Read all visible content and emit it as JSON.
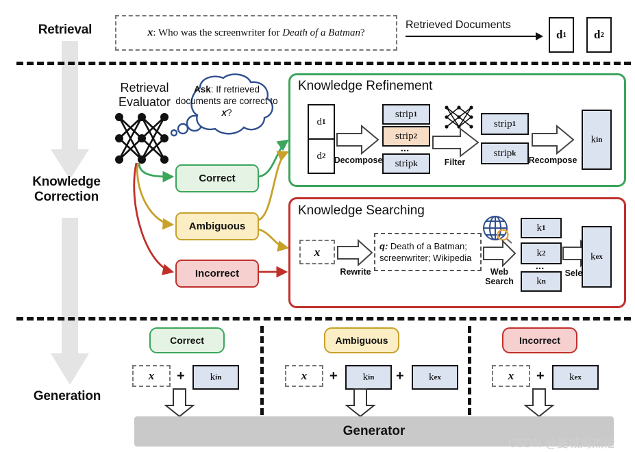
{
  "stages": [
    {
      "id": "retrieval",
      "label": "Retrieval"
    },
    {
      "id": "correction",
      "label": "Knowledge\nCorrection",
      "line1": "Knowledge",
      "line2": "Correction"
    },
    {
      "id": "generation",
      "label": "Generation"
    }
  ],
  "retrieval": {
    "query_prefix": "x",
    "query_text": ": Who was the screenwriter for ",
    "query_italic": "Death of a Batman",
    "query_suffix": "?",
    "arrow_label": "Retrieved Documents",
    "documents": [
      {
        "base": "d",
        "sub": "1"
      },
      {
        "base": "d",
        "sub": "2"
      }
    ]
  },
  "evaluator": {
    "title_line1": "Retrieval",
    "title_line2": "Evaluator",
    "bubble_bold": "Ask",
    "bubble_rest": ": If retrieved documents are correct to ",
    "bubble_var": "x",
    "bubble_end": "?"
  },
  "categories": [
    {
      "id": "correct",
      "label": "Correct",
      "border": "#3ba55c",
      "fill": "#e4f3e3"
    },
    {
      "id": "ambiguous",
      "label": "Ambiguous",
      "border": "#c8a12a",
      "fill": "#fbeec4"
    },
    {
      "id": "incorrect",
      "label": "Incorrect",
      "border": "#c0302b",
      "fill": "#f6cfcf"
    }
  ],
  "refinement": {
    "title": "Knowledge Refinement",
    "border": "#3ba55c",
    "inputs": [
      {
        "base": "d",
        "sub": "1"
      },
      {
        "base": "d",
        "sub": "2"
      }
    ],
    "step1_caption": "Decompose",
    "strips_in": [
      {
        "base": "strip",
        "sub": "1",
        "style": "blue"
      },
      {
        "base": "strip",
        "sub": "2",
        "style": "peach"
      },
      {
        "base": "strip",
        "sub": "k",
        "style": "blue"
      }
    ],
    "ellipsis": "...",
    "step2_caption": "Filter",
    "strips_out": [
      {
        "base": "strip",
        "sub": "1"
      },
      {
        "base": "strip",
        "sub": "k"
      }
    ],
    "step3_caption": "Recompose",
    "output": {
      "base": "k",
      "sub": "in"
    }
  },
  "searching": {
    "title": "Knowledge Searching",
    "border": "#c0302b",
    "input_var": "x",
    "step1_caption": "Rewrite",
    "query_label": "q:",
    "query_line1": " Death of a Batman;",
    "query_line2": "screenwriter; Wikipedia",
    "step2_caption_line1": "Web",
    "step2_caption_line2": "Search",
    "results": [
      {
        "base": "k",
        "sub": "1"
      },
      {
        "base": "k",
        "sub": "2"
      },
      {
        "base": "k",
        "sub": "n"
      }
    ],
    "ellipsis": "...",
    "step3_caption": "Select",
    "output": {
      "base": "k",
      "sub": "ex"
    }
  },
  "generation": {
    "columns": [
      {
        "id": "correct",
        "pill": "Correct",
        "border": "#3ba55c",
        "fill": "#e4f3e3",
        "input_var": "x",
        "plus": "+",
        "knowledge": [
          {
            "base": "k",
            "sub": "in"
          }
        ]
      },
      {
        "id": "ambiguous",
        "pill": "Ambiguous",
        "border": "#c8a12a",
        "fill": "#fbeec4",
        "input_var": "x",
        "plus": "+",
        "knowledge": [
          {
            "base": "k",
            "sub": "in"
          },
          {
            "base": "k",
            "sub": "ex"
          }
        ]
      },
      {
        "id": "incorrect",
        "pill": "Incorrect",
        "border": "#c0302b",
        "fill": "#f6cfcf",
        "input_var": "x",
        "plus": "+",
        "knowledge": [
          {
            "base": "k",
            "sub": "ex"
          }
        ]
      }
    ],
    "generator_label": "Generator"
  },
  "watermark": "CSDN @曼城周杰伦",
  "colors": {
    "green": "#3ba55c",
    "gold": "#c8a12a",
    "red": "#c0302b",
    "box_blue": "#dbe2f0",
    "box_peach": "#f7ddc6",
    "gray_arrow": "#e4e4e4",
    "generator_gray": "#c9c9c9",
    "ink": "#111111"
  }
}
